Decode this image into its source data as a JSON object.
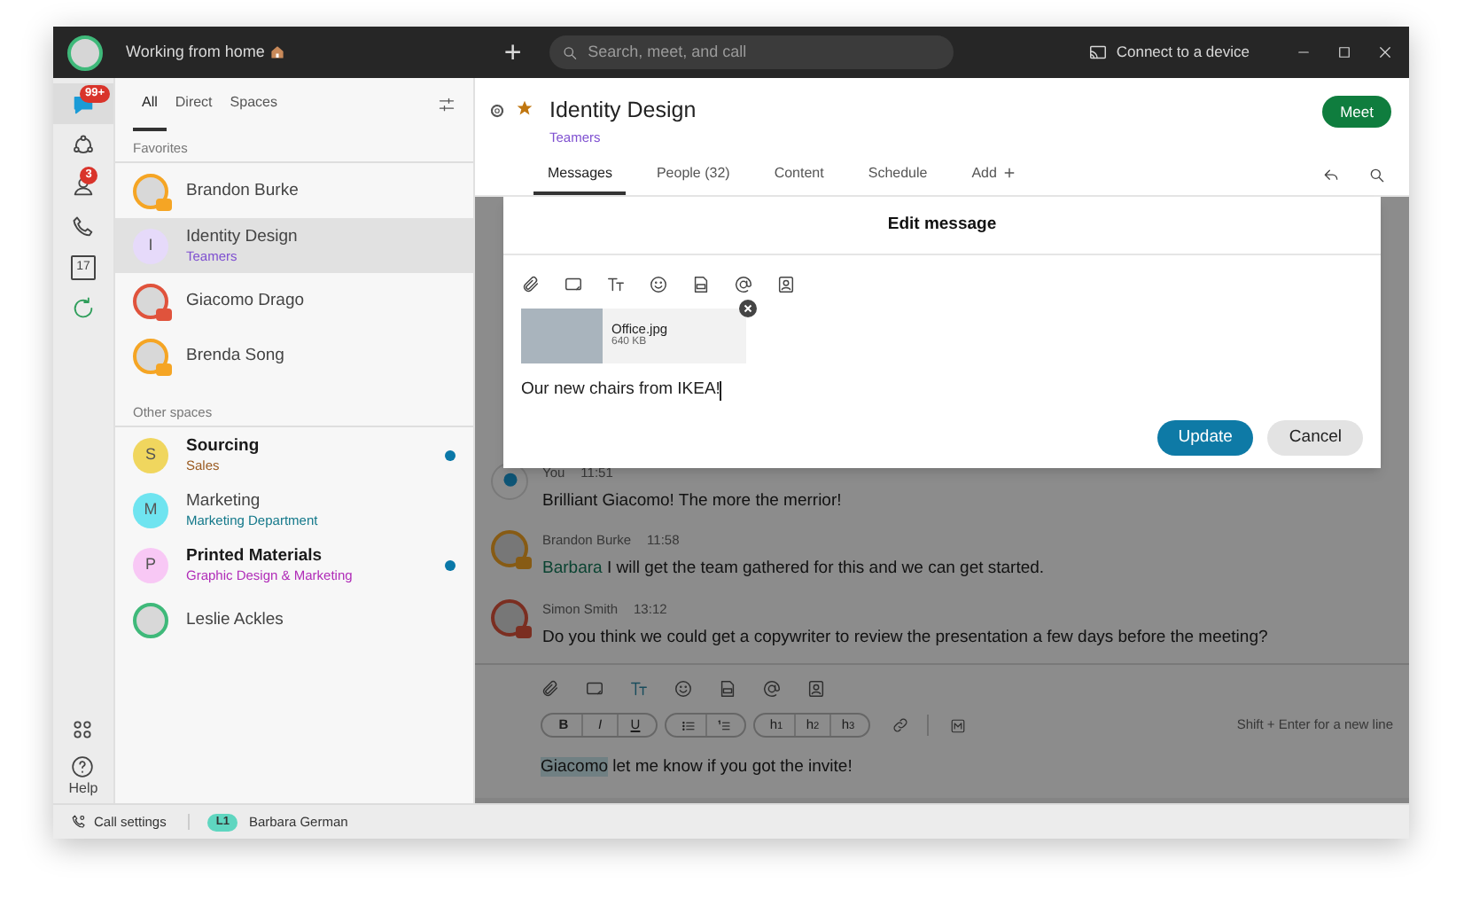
{
  "title_bar": {
    "status": "Working from home",
    "add_label": "+",
    "search": {
      "placeholder": "Search, meet, and call"
    },
    "connect": "Connect to a device"
  },
  "rail": {
    "items": [
      {
        "kind": "chat",
        "badge": "99+",
        "selected": true
      },
      {
        "kind": "teams",
        "selected": false
      },
      {
        "kind": "contacts",
        "badge": "3",
        "selected": false
      },
      {
        "kind": "calls",
        "selected": false
      },
      {
        "kind": "calendar",
        "day": "17",
        "selected": false
      },
      {
        "kind": "refresh",
        "selected": false
      }
    ],
    "bottom": [
      {
        "kind": "apps"
      },
      {
        "kind": "help",
        "label": "Help"
      }
    ]
  },
  "list": {
    "tabs": [
      {
        "label": "All",
        "selected": true
      },
      {
        "label": "Direct",
        "selected": false
      },
      {
        "label": "Spaces",
        "selected": false
      }
    ],
    "sections": [
      {
        "title": "Favorites",
        "items": [
          {
            "name": "Brandon Burke",
            "kind": "photo",
            "color": "#f5a524",
            "badge": true,
            "selected": false,
            "unread": false
          },
          {
            "name": "Identity Design",
            "subtitle": {
              "text": "Teamers",
              "color": "#7e4fd0"
            },
            "kind": "letter",
            "letter": "I",
            "color": "#e6dafa",
            "selected": true,
            "unread": false
          },
          {
            "name": "Giacomo Drago",
            "kind": "photo",
            "color": "#e0533c",
            "badge": true,
            "selected": false,
            "unread": false
          },
          {
            "name": "Brenda Song",
            "kind": "photo",
            "color": "#f5a524",
            "badge": true,
            "selected": false,
            "unread": false
          }
        ]
      },
      {
        "title": "Other spaces",
        "items": [
          {
            "name": "Sourcing",
            "subtitle": {
              "text": "Sales",
              "color": "#9a5b22"
            },
            "kind": "letter",
            "letter": "S",
            "color": "#f0d65e",
            "selected": false,
            "unread": true
          },
          {
            "name": "Marketing",
            "subtitle": {
              "text": "Marketing Department",
              "color": "#13788a"
            },
            "kind": "letter",
            "letter": "M",
            "color": "#6fe4f0",
            "selected": false,
            "unread": false
          },
          {
            "name": "Printed Materials",
            "subtitle": {
              "text": "Graphic Design & Marketing",
              "color": "#b02cb8"
            },
            "kind": "letter",
            "letter": "P",
            "color": "#f8c8f5",
            "selected": false,
            "unread": true
          },
          {
            "name": "Leslie Ackles",
            "kind": "photo",
            "color": "#3fb97a",
            "badge": false,
            "selected": false,
            "unread": false
          }
        ]
      }
    ]
  },
  "space": {
    "title": "Identity Design",
    "subtitle": "Teamers",
    "favorite": true,
    "meet_button": "Meet",
    "tabs": [
      {
        "label": "Messages",
        "selected": true
      },
      {
        "label": "People (32)",
        "selected": false
      },
      {
        "label": "Content",
        "selected": false
      },
      {
        "label": "Schedule",
        "selected": false
      },
      {
        "label": "Add",
        "kind": "add",
        "selected": false
      }
    ]
  },
  "messages": [
    {
      "sender": "You",
      "time": "11:51",
      "kind": "self",
      "text": "Brilliant Giacomo! The more the merrior!"
    },
    {
      "sender": "Brandon Burke",
      "time": "11:58",
      "kind": "photo",
      "color": "#875b14",
      "badge": true,
      "mention": "Barbara",
      "text": " I will get the team gathered for this and we can get started."
    },
    {
      "sender": "Simon Smith",
      "time": "13:12",
      "kind": "photo",
      "color": "#7b2e21",
      "badge": true,
      "text": "Do you think we could get a copywriter to review the presentation a few days before the meeting?"
    }
  ],
  "composer": {
    "format_groups": [
      [
        {
          "kind": "bold",
          "label": "B"
        },
        {
          "kind": "italic",
          "label": "I"
        },
        {
          "kind": "underline",
          "label": "U"
        }
      ],
      [
        {
          "kind": "bullets"
        },
        {
          "kind": "numbers"
        }
      ],
      [
        {
          "kind": "heading",
          "label": "h$_{1}$"
        },
        {
          "kind": "heading",
          "label": "h$_{2}$"
        },
        {
          "kind": "heading",
          "label": "h$_{3}$"
        }
      ]
    ],
    "hint": "Shift + Enter for a new line",
    "mention": "Giacomo",
    "draft": " let me know if you got the invite!"
  },
  "edit_dialog": {
    "title": "Edit message",
    "attachment": {
      "name": "Office.jpg",
      "size": "640 KB"
    },
    "text": "Our new chairs from IKEA!",
    "buttons": [
      {
        "label": "Update",
        "kind": "primary"
      },
      {
        "label": "Cancel",
        "kind": "secondary"
      }
    ]
  },
  "status_bar": {
    "call_settings": "Call settings",
    "line": "L1",
    "user": "Barbara German"
  }
}
